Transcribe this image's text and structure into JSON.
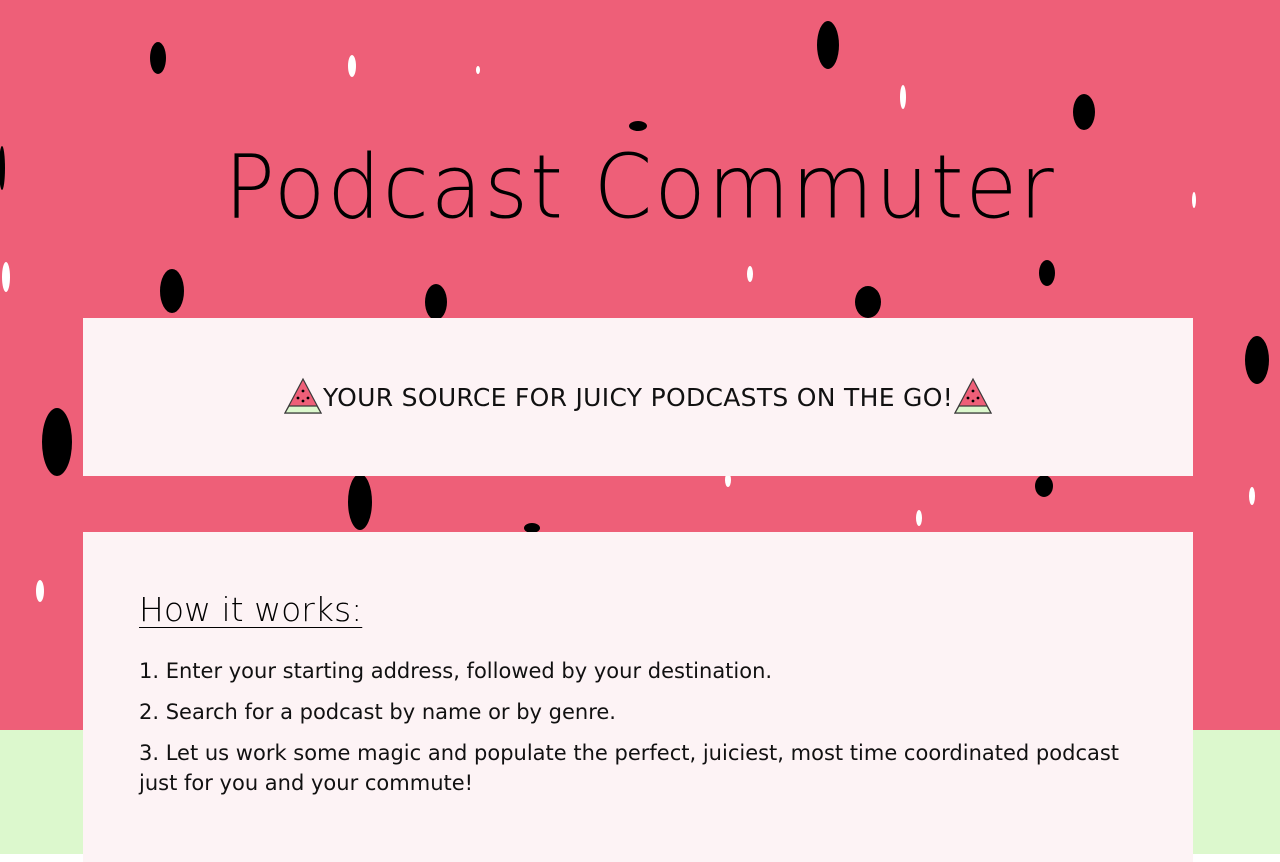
{
  "header": {
    "title": "Podcast Commuter"
  },
  "tagline": {
    "text": "YOUR SOURCE FOR JUICY PODCASTS ON THE GO!",
    "icon": "watermelon-slice-icon"
  },
  "how_it_works": {
    "heading": "How it works:",
    "steps": [
      "1. Enter your starting address, followed by your destination.",
      "2. Search for a podcast by name or by genre.",
      "3. Let us work some magic and populate the perfect, juiciest, most time coordinated podcast just for you and your commute!"
    ]
  },
  "colors": {
    "watermelon_pink": "#ee5f78",
    "rind_green": "#dcf8cd",
    "seed_black": "#000000",
    "card_background": "#fdf3f5"
  }
}
